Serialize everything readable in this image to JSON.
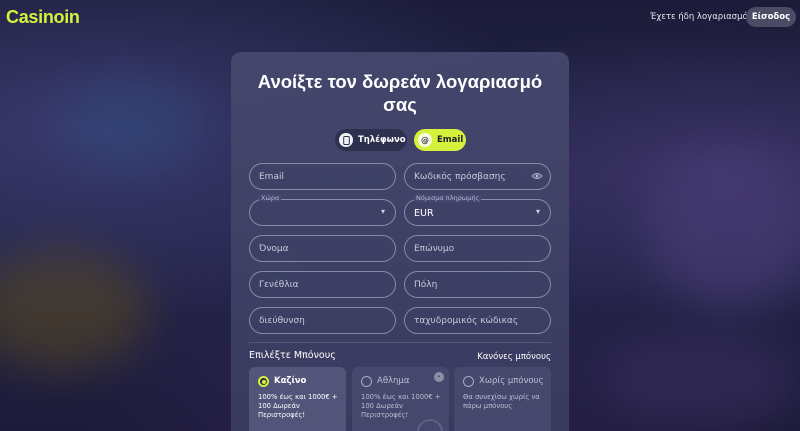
{
  "header": {
    "logo": "Casinoin",
    "have_account": "Έχετε ήδη λογαριασμό;",
    "login_label": "Είσοδος"
  },
  "form": {
    "title": "Ανοίξτε τον δωρεάν λογαριασμό σας",
    "tabs": [
      {
        "label": "Τηλέφωνο",
        "icon": "phone-icon",
        "active": false
      },
      {
        "label": "Email",
        "icon": "at-icon",
        "active": true
      }
    ],
    "fields": {
      "email": {
        "placeholder": "Email"
      },
      "password": {
        "placeholder": "Κωδικός πρόσβασης"
      },
      "country": {
        "label": "Χώρα",
        "value": ""
      },
      "currency": {
        "label": "Νόμισμα πληρωμής",
        "value": "EUR"
      },
      "first_name": {
        "placeholder": "Όνομα"
      },
      "last_name": {
        "placeholder": "Επώνυμο"
      },
      "birthdate": {
        "placeholder": "Γενέθλια"
      },
      "city": {
        "placeholder": "Πόλη"
      },
      "address": {
        "placeholder": "διεύθυνση"
      },
      "postcode": {
        "placeholder": "ταχυδρομικός κώδικας"
      }
    },
    "bonus": {
      "title": "Επιλέξτε Μπόνους",
      "rules": "Κανόνες μπόνους",
      "options": [
        {
          "name": "Καζίνο",
          "desc": "100% έως και 1000€ + 100 Δωρεάν Περιστροφές!",
          "selected": true
        },
        {
          "name": "Αθλημα",
          "desc": "100% έως και 1000€ + 100 Δωρεάν Περιστροφές!",
          "selected": false
        },
        {
          "name": "Χωρίς μπόνους",
          "desc": "Θα συνεχίσω χωρίς να πάρω μπόνους",
          "selected": false
        }
      ]
    }
  },
  "colors": {
    "accent": "#d6f13c",
    "card": "#46486e",
    "background": "#1c1c3a"
  }
}
